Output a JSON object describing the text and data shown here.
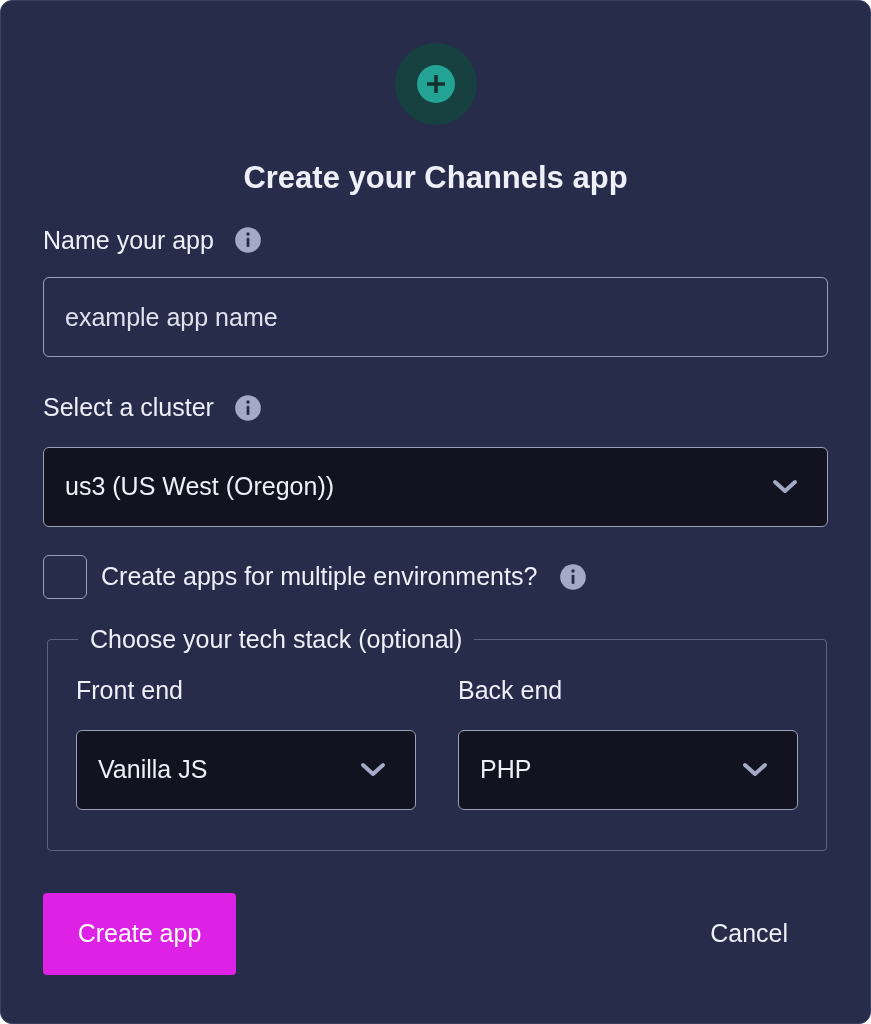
{
  "title": "Create your Channels app",
  "name_field": {
    "label": "Name your app",
    "placeholder": "example app name"
  },
  "cluster_field": {
    "label": "Select a cluster",
    "value": "us3 (US West (Oregon))"
  },
  "multi_env": {
    "label": "Create apps for multiple environments?",
    "checked": false
  },
  "tech_stack": {
    "legend": "Choose your tech stack (optional)",
    "selects": [
      {
        "label": "Front end",
        "value": "Vanilla JS"
      },
      {
        "label": "Back end",
        "value": "PHP"
      }
    ]
  },
  "buttons": [
    {
      "label": "Create app",
      "kind": "primary"
    },
    {
      "label": "Cancel",
      "kind": "link"
    }
  ]
}
